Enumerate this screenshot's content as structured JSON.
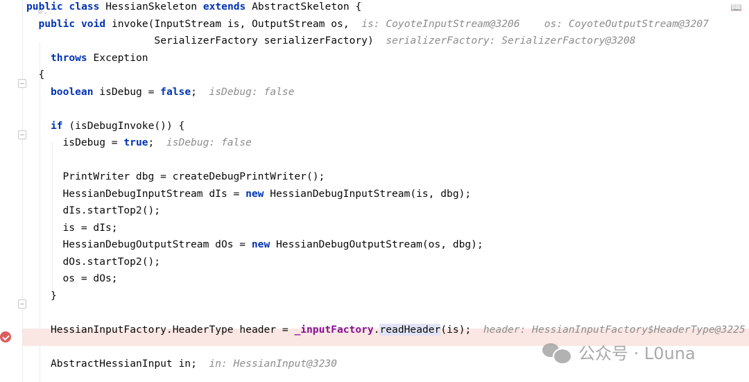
{
  "editor": {
    "code_lines": [
      {
        "indent": 0,
        "parts": [
          {
            "t": "public class",
            "s": "kw"
          },
          {
            "t": " HessianSkeleton "
          },
          {
            "t": "extends",
            "s": "kw"
          },
          {
            "t": " AbstractSkeleton {"
          }
        ]
      },
      {
        "indent": 1,
        "parts": [
          {
            "t": "public void",
            "s": "kw"
          },
          {
            "t": " invoke(InputStream is, OutputStream os,  "
          },
          {
            "t": "is: CoyoteInputStream@3206    os: CoyoteOutputStream@3207",
            "s": "hint"
          }
        ]
      },
      {
        "indent": 1,
        "parts": [
          {
            "t": "                   SerializerFactory serializerFactory)  "
          },
          {
            "t": "serializerFactory: SerializerFactory@3208",
            "s": "hint"
          }
        ]
      },
      {
        "indent": 2,
        "parts": [
          {
            "t": "throws",
            "s": "kw"
          },
          {
            "t": " Exception"
          }
        ]
      },
      {
        "indent": 1,
        "parts": [
          {
            "t": "{"
          }
        ]
      },
      {
        "indent": 2,
        "parts": [
          {
            "t": "boolean",
            "s": "kw"
          },
          {
            "t": " isDebug = "
          },
          {
            "t": "false",
            "s": "kw"
          },
          {
            "t": ";  "
          },
          {
            "t": "isDebug: false",
            "s": "hint"
          }
        ]
      },
      {
        "indent": 0,
        "parts": []
      },
      {
        "indent": 2,
        "parts": [
          {
            "t": "if",
            "s": "kw"
          },
          {
            "t": " (isDebugInvoke()) {"
          }
        ]
      },
      {
        "indent": 3,
        "parts": [
          {
            "t": "isDebug = "
          },
          {
            "t": "true",
            "s": "kw"
          },
          {
            "t": ";  "
          },
          {
            "t": "isDebug: false",
            "s": "hint"
          }
        ]
      },
      {
        "indent": 0,
        "parts": []
      },
      {
        "indent": 3,
        "parts": [
          {
            "t": "PrintWriter dbg = createDebugPrintWriter();"
          }
        ]
      },
      {
        "indent": 3,
        "parts": [
          {
            "t": "HessianDebugInputStream dIs = "
          },
          {
            "t": "new",
            "s": "kw"
          },
          {
            "t": " HessianDebugInputStream(is, dbg);"
          }
        ]
      },
      {
        "indent": 3,
        "parts": [
          {
            "t": "dIs.startTop2();"
          }
        ]
      },
      {
        "indent": 3,
        "parts": [
          {
            "t": "is = dIs;"
          }
        ]
      },
      {
        "indent": 3,
        "parts": [
          {
            "t": "HessianDebugOutputStream dOs = "
          },
          {
            "t": "new",
            "s": "kw"
          },
          {
            "t": " HessianDebugOutputStream(os, dbg);"
          }
        ]
      },
      {
        "indent": 3,
        "parts": [
          {
            "t": "dOs.startTop2();"
          }
        ]
      },
      {
        "indent": 3,
        "parts": [
          {
            "t": "os = dOs;"
          }
        ]
      },
      {
        "indent": 2,
        "parts": [
          {
            "t": "}"
          }
        ]
      },
      {
        "indent": 0,
        "parts": []
      },
      {
        "indent": 2,
        "parts": [
          {
            "t": "HessianInputFactory.HeaderType header = "
          },
          {
            "t": "_inputFactory",
            "s": "field"
          },
          {
            "t": "."
          },
          {
            "t": "readHeader",
            "s": "hl"
          },
          {
            "t": "(is);  "
          },
          {
            "t": "header: HessianInputFactory$HeaderType@3225",
            "s": "hint"
          }
        ]
      },
      {
        "indent": 0,
        "parts": []
      },
      {
        "indent": 2,
        "parts": [
          {
            "t": "AbstractHessianInput in;  "
          },
          {
            "t": "in: HessianInput@3230",
            "s": "hint"
          }
        ]
      }
    ],
    "breakpoint_line": 19,
    "colors": {
      "keyword": "#0033b3",
      "hint": "#8c8c8c",
      "field": "#871094",
      "breakpoint_bg": "#fae6e3",
      "breakpoint": "#db5c5c"
    }
  },
  "icons": {
    "breakpoint": "breakpoint-check-icon",
    "reader_mode": "book-icon",
    "fold": "fold-icon"
  },
  "watermark": {
    "text": "公众号 · L0una"
  }
}
